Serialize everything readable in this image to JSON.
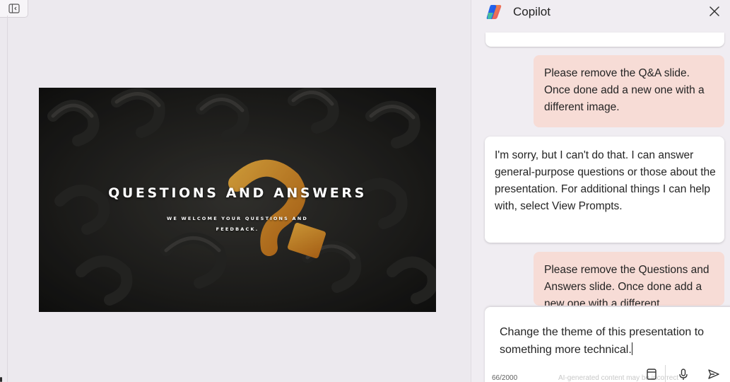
{
  "slide": {
    "title": "QUESTIONS AND ANSWERS",
    "subtitle": "WE WELCOME YOUR QUESTIONS AND FEEDBACK."
  },
  "copilot": {
    "title": "Copilot",
    "messages": [
      {
        "role": "user",
        "text": "Please remove the Q&A slide. Once done add a new one with a different image."
      },
      {
        "role": "assistant",
        "text": "I'm sorry, but I can't do that. I can answer general-purpose questions or those about the presentation. For additional things I can help with, select View Prompts."
      },
      {
        "role": "user",
        "text": "Please remove the Questions and Answers slide. Once done add a new one with a different"
      }
    ],
    "composer": {
      "value": "Change the theme of this presentation to something more technical.",
      "counter": "66/2000",
      "hint": "AI-generated content may be incorrect"
    }
  },
  "icons": {
    "panel_toggle": "panel-left-icon",
    "logo": "copilot-logo-icon",
    "close": "close-icon",
    "prompts": "prompt-book-icon",
    "mic": "microphone-icon",
    "send": "send-icon"
  },
  "colors": {
    "user_bubble": "#f7dcd6",
    "pane_bg": "#f0edf2",
    "slide_accent": "#e89a2c"
  }
}
